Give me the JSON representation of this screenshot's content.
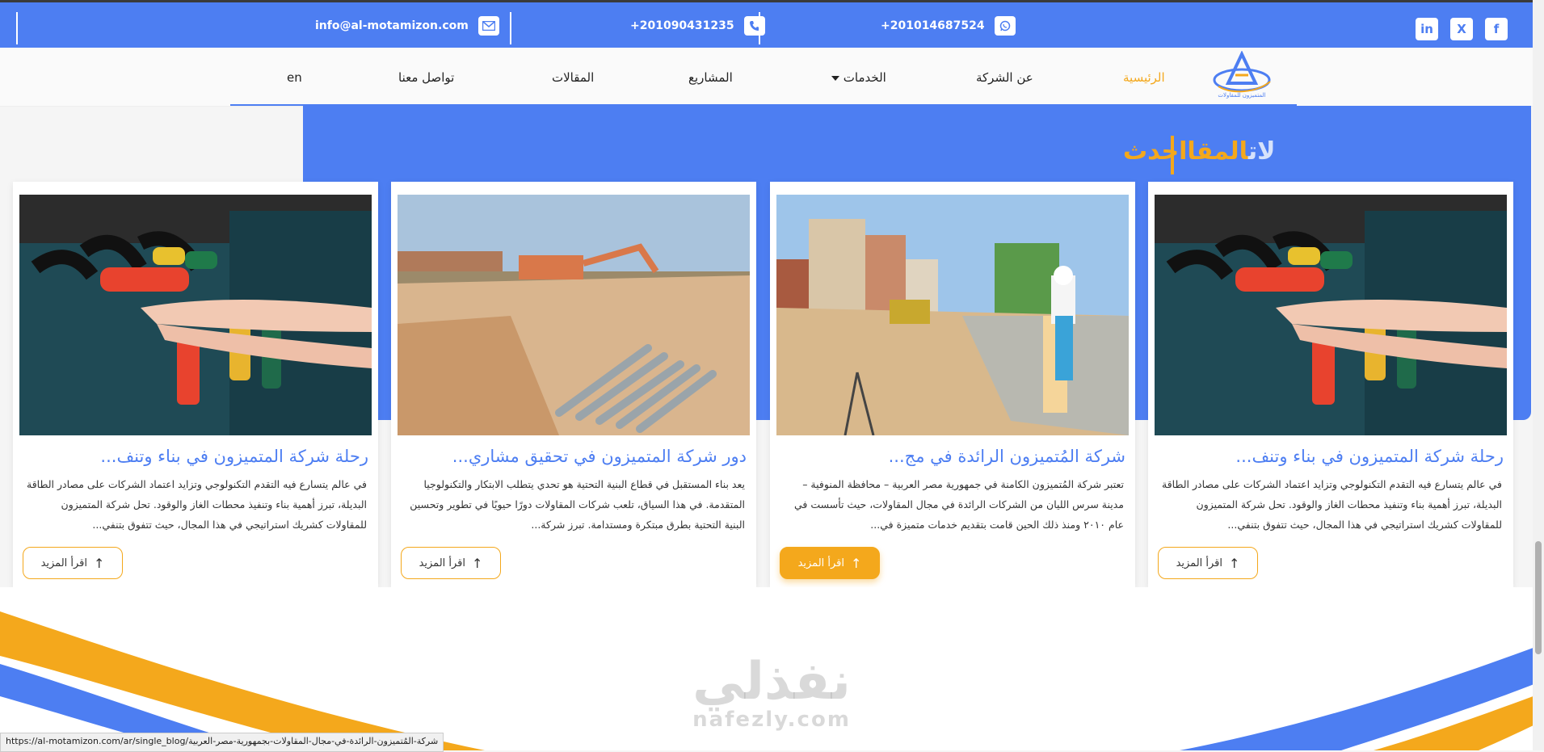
{
  "topbar": {
    "email": "info@al-motamizon.com",
    "phone": "+201090431235",
    "whatsapp": "+201014687524",
    "social": [
      "in",
      "X",
      "f"
    ]
  },
  "nav": {
    "home": "الرئيسية",
    "about": "عن الشركة",
    "services": "الخدمات",
    "projects": "المشاريع",
    "articles": "المقالات",
    "contact": "تواصل معنا",
    "lang": "en"
  },
  "logo_text": "المتميزون للمقاولات",
  "section": {
    "title_a": "احدث ",
    "title_b": "المقا",
    "title_c": "لات"
  },
  "cards": [
    {
      "title": "رحلة شركة المتميزون في بناء وتنف...",
      "text": "في عالم يتسارع فيه التقدم التكنولوجي وتزايد اعتماد الشركات على مصادر الطاقة البديلة، تبرز أهمية بناء وتنفيذ محطات الغاز والوقود. تحل شركة المتميزون للمقاولات كشريك استراتيجي في هذا المجال، حيث تتفوق بتنفي...",
      "button": "اقرأ المزيد"
    },
    {
      "title": "شركة المُتميزون الرائدة في مج...",
      "text": "تعتبر شركة المُتميزون الكامنة في جمهورية مصر العربية – محافظة المنوفية – مدينة سرس الليان من الشركات الرائدة في مجال المقاولات، حيث تأسست في عام ٢٠١٠ ومنذ ذلك الحين قامت بتقديم خدمات متميزة في...",
      "button": "اقرأ المزيد"
    },
    {
      "title": "دور شركة المتميزون في تحقيق مشاري...",
      "text": "يعد بناء المستقبل في قطاع البنية التحتية هو تحدي يتطلب الابتكار والتكنولوجيا المتقدمة. في هذا السياق، تلعب شركات المقاولات دورًا حيويًا في تطوير وتحسين البنية التحتية بطرق مبتكرة ومستدامة. تبرز شركة...",
      "button": "اقرأ المزيد"
    },
    {
      "title": "رحلة شركة المتميزون في بناء وتنف...",
      "text": "في عالم يتسارع فيه التقدم التكنولوجي وتزايد اعتماد الشركات على مصادر الطاقة البديلة، تبرز أهمية بناء وتنفيذ محطات الغاز والوقود. تحل شركة المتميزون للمقاولات كشريك استراتيجي في هذا المجال، حيث تتفوق بتنفي...",
      "button": "اقرأ المزيد"
    }
  ],
  "watermark": {
    "ar": "نفذلي",
    "en": "nafezly.com"
  },
  "status_url": "https://al-motamizon.com/ar/single_blog/شركة-المُتميزون-الرائدة-في-مجال-المقاولات-بجمهورية-مصر-العربية",
  "colors": {
    "brand_blue": "#4d7ef2",
    "accent_orange": "#f4a81c"
  }
}
